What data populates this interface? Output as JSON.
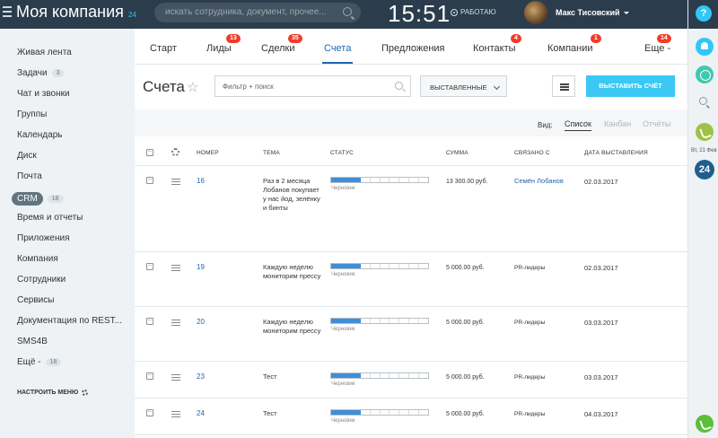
{
  "header": {
    "company_name": "Моя компания",
    "company_num": "24",
    "search_placeholder": "искать сотрудника, документ, прочее...",
    "clock": "15:51",
    "work_status": "РАБОТАЮ",
    "user_name": "Макс Тисовский"
  },
  "right_panel": {
    "help": "?",
    "date": "Вт, 21 Фев",
    "bitrix": "24"
  },
  "menu": {
    "items": [
      {
        "label": "Живая лента",
        "count": ""
      },
      {
        "label": "Задачи",
        "count": "3"
      },
      {
        "label": "Чат и звонки",
        "count": ""
      },
      {
        "label": "Группы",
        "count": ""
      },
      {
        "label": "Календарь",
        "count": ""
      },
      {
        "label": "Диск",
        "count": ""
      },
      {
        "label": "Почта",
        "count": ""
      },
      {
        "label": "CRM",
        "count": "18",
        "active": true
      },
      {
        "label": "Время и отчеты",
        "count": ""
      },
      {
        "label": "Приложения",
        "count": ""
      },
      {
        "label": "Компания",
        "count": ""
      },
      {
        "label": "Сотрудники",
        "count": ""
      },
      {
        "label": "Сервисы",
        "count": ""
      },
      {
        "label": "Документация по REST...",
        "count": ""
      },
      {
        "label": "SMS4B",
        "count": ""
      },
      {
        "label": "Ещё -",
        "count": "18"
      }
    ],
    "settings": "НАСТРОИТЬ МЕНЮ"
  },
  "tabs": [
    {
      "label": "Старт",
      "badge": ""
    },
    {
      "label": "Лиды",
      "badge": "13"
    },
    {
      "label": "Сделки",
      "badge": "35"
    },
    {
      "label": "Счета",
      "badge": "",
      "active": true
    },
    {
      "label": "Предложения",
      "badge": ""
    },
    {
      "label": "Контакты",
      "badge": "4"
    },
    {
      "label": "Компании",
      "badge": "1"
    },
    {
      "label": "Еще -",
      "badge": "14"
    }
  ],
  "toolbar": {
    "title": "Счета",
    "filter_placeholder": "Фильтр + поиск",
    "dropdown": "ВЫСТАВЛЕННЫЕ",
    "create": "ВЫСТАВИТЬ СЧЁТ"
  },
  "view": {
    "label": "Вид:",
    "options": [
      "Список",
      "Канбан",
      "Отчёты"
    ]
  },
  "table": {
    "columns": [
      "НОМЕР",
      "ТЕМА",
      "СТАТУС",
      "СУММА",
      "СВЯЗАНО С",
      "ДАТА ВЫСТАВЛЕНИЯ"
    ],
    "status_label": "Черновик",
    "progress": 0.25,
    "rows": [
      {
        "num": "16",
        "subject": "Раз в 2 месяца Лобанов покупает у нас йод, зелёнку и бинты",
        "sum": "13 300.00 руб.",
        "related": "Семён Лобанов",
        "related_link": true,
        "date": "02.03.2017"
      },
      {
        "num": "19",
        "subject": "Каждую неделю мониторим прессу",
        "sum": "5 000.00 руб.",
        "related": "PR-лидеры",
        "related_link": false,
        "date": "02.03.2017"
      },
      {
        "num": "20",
        "subject": "Каждую неделю мониторим прессу",
        "sum": "5 000.00 руб.",
        "related": "PR-лидеры",
        "related_link": false,
        "date": "03.03.2017"
      },
      {
        "num": "23",
        "subject": "Тест",
        "sum": "5 000.00 руб.",
        "related": "PR-лидеры",
        "related_link": false,
        "date": "03.03.2017"
      },
      {
        "num": "24",
        "subject": "Тест",
        "sum": "5 000.00 руб.",
        "related": "PR-лидеры",
        "related_link": false,
        "date": "04.03.2017"
      }
    ]
  },
  "colors": {
    "header_bg": "#2b3d4c",
    "accent": "#3bc8f5",
    "link": "#2067b0",
    "badge": "#f03c2a"
  }
}
